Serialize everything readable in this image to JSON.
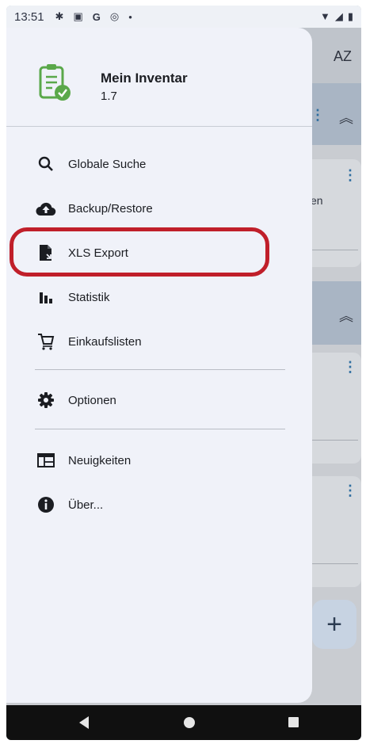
{
  "status_bar": {
    "time": "13:51",
    "left_icons": [
      "gear-icon",
      "photo-icon",
      "google-icon",
      "sync-icon",
      "dot-icon"
    ],
    "right_icons": [
      "wifi-icon",
      "signal-icon",
      "battery-icon"
    ]
  },
  "background": {
    "sort_label": "AZ",
    "partial_text": "en",
    "fab_label": "+"
  },
  "drawer": {
    "app_name": "Mein Inventar",
    "app_version": "1.7",
    "items": [
      {
        "label": "Globale Suche",
        "icon": "search-icon"
      },
      {
        "label": "Backup/Restore",
        "icon": "cloud-upload-icon"
      },
      {
        "label": "XLS Export",
        "icon": "file-export-icon"
      },
      {
        "label": "Statistik",
        "icon": "bar-chart-icon"
      },
      {
        "label": "Einkaufslisten",
        "icon": "shopping-cart-icon"
      },
      {
        "label": "Optionen",
        "icon": "gear-icon"
      },
      {
        "label": "Neuigkeiten",
        "icon": "news-icon"
      },
      {
        "label": "Über...",
        "icon": "info-icon"
      }
    ]
  },
  "colors": {
    "drawer_bg": "#f0f2f9",
    "highlight": "#c01f2a",
    "logo_green": "#5aa84a"
  }
}
